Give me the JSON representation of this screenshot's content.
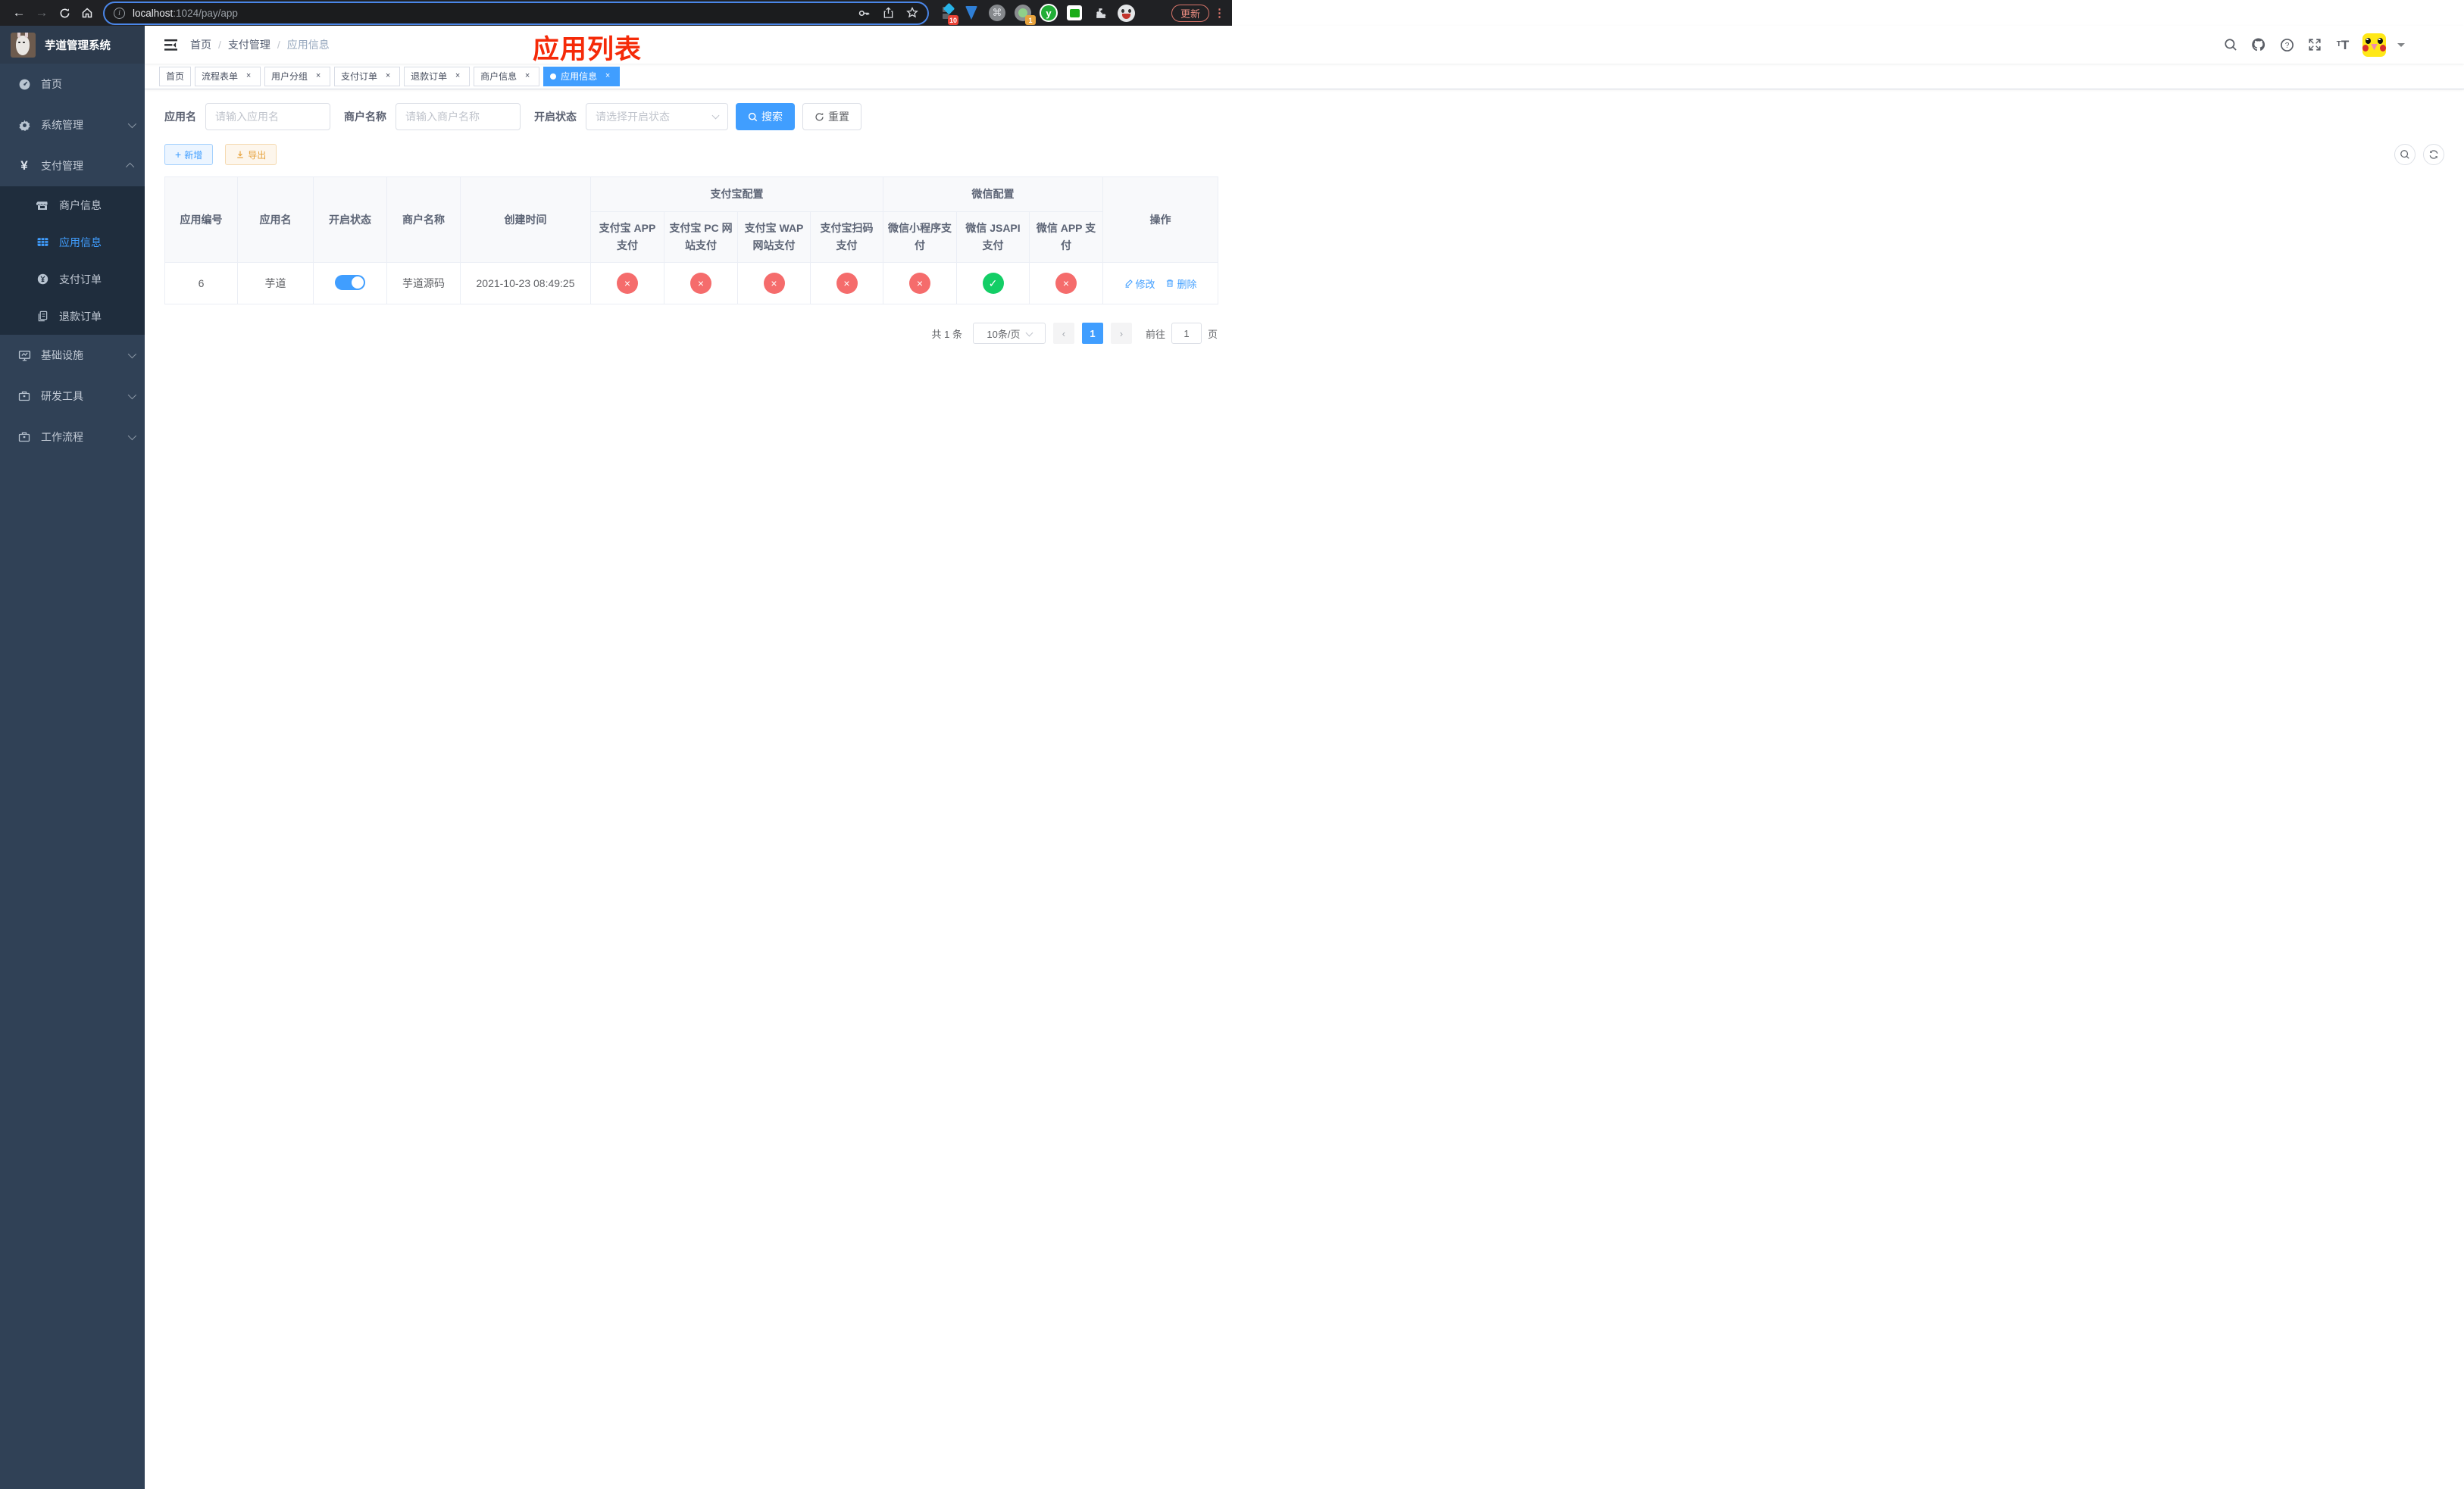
{
  "colors": {
    "accent": "#409eff",
    "danger": "#f56c6c",
    "success": "#13ce66",
    "warning": "#e6a23c",
    "annotation_red": "#f52a08",
    "sidebar_bg": "#304156",
    "submenu_bg": "#1f2d3d"
  },
  "browser": {
    "url_host": "localhost",
    "url_rest": ":1024/pay/app",
    "update_button": "更新",
    "ext_badge_grid": "10",
    "ext_badge_profile": "1",
    "ext_y_letter": "y"
  },
  "sidebar": {
    "title": "芋道管理系统",
    "menu": [
      {
        "label": "首页",
        "chevron": ""
      },
      {
        "label": "系统管理",
        "chevron": "down"
      },
      {
        "label": "支付管理",
        "chevron": "up"
      },
      {
        "label": "商户信息",
        "state": ""
      },
      {
        "label": "应用信息",
        "state": "active"
      },
      {
        "label": "支付订单",
        "state": ""
      },
      {
        "label": "退款订单",
        "state": ""
      },
      {
        "label": "基础设施",
        "chevron": "down"
      },
      {
        "label": "研发工具",
        "chevron": "down"
      },
      {
        "label": "工作流程",
        "chevron": "down"
      }
    ]
  },
  "navbar": {
    "breadcrumb": [
      "首页",
      "支付管理",
      "应用信息"
    ],
    "annotation": "应用列表"
  },
  "tabs": [
    {
      "label": "首页",
      "cls": ""
    },
    {
      "label": "流程表单",
      "cls": "closable"
    },
    {
      "label": "用户分组",
      "cls": "closable"
    },
    {
      "label": "支付订单",
      "cls": "closable"
    },
    {
      "label": "退款订单",
      "cls": "closable"
    },
    {
      "label": "商户信息",
      "cls": "closable"
    },
    {
      "label": "应用信息",
      "cls": "closable active"
    }
  ],
  "tab_close_glyph": "×",
  "search": {
    "app_name_label": "应用名",
    "app_name_placeholder": "请输入应用名",
    "merchant_label": "商户名称",
    "merchant_placeholder": "请输入商户名称",
    "status_label": "开启状态",
    "status_placeholder": "请选择开启状态",
    "search_button": "搜索",
    "reset_button": "重置"
  },
  "toolbar": {
    "add_button": "新增",
    "export_button": "导出"
  },
  "table": {
    "group_alipay": "支付宝配置",
    "group_wechat": "微信配置",
    "col_id": "应用编号",
    "col_name": "应用名",
    "col_status": "开启状态",
    "col_merchant": "商户名称",
    "col_created": "创建时间",
    "col_op": "操作",
    "sub_cols": [
      "支付宝 APP 支付",
      "支付宝 PC 网站支付",
      "支付宝 WAP 网站支付",
      "支付宝扫码支付",
      "微信小程序支付",
      "微信 JSAPI 支付",
      "微信 APP 支付"
    ],
    "row": {
      "id": "6",
      "name": "芋道",
      "switch_state": "on",
      "merchant": "芋道源码",
      "created_at": "2021-10-23 08:49:25",
      "channels": [
        {
          "state": "off",
          "glyph": "×"
        },
        {
          "state": "off",
          "glyph": "×"
        },
        {
          "state": "off",
          "glyph": "×"
        },
        {
          "state": "off",
          "glyph": "×"
        },
        {
          "state": "off",
          "glyph": "×"
        },
        {
          "state": "on",
          "glyph": "✓"
        },
        {
          "state": "off",
          "glyph": "×"
        }
      ],
      "edit_link": "修改",
      "delete_link": "删除"
    }
  },
  "pagination": {
    "total": "共 1 条",
    "page_size": "10条/页",
    "prev": "‹",
    "page": "1",
    "next": "›",
    "goto_prefix": "前往",
    "goto_value": "1",
    "goto_suffix": "页"
  }
}
